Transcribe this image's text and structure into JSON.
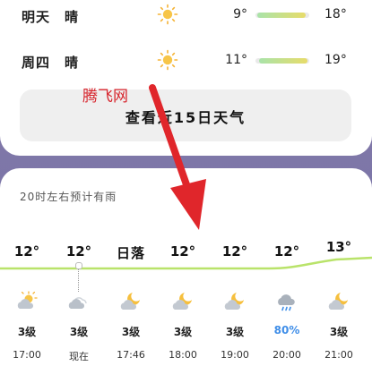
{
  "daily": [
    {
      "day": "明天",
      "condition": "晴",
      "icon": "sun-icon",
      "low": "9°",
      "high": "18°"
    },
    {
      "day": "周四",
      "condition": "晴",
      "icon": "sun-icon",
      "low": "11°",
      "high": "19°"
    }
  ],
  "forecast_button": "查看近15日天气",
  "watermark": "腾飞网",
  "rain_note": "20时左右预计有雨",
  "hourly": [
    {
      "temp": "12°",
      "icon": "partly-sunny-icon",
      "wind": "3级",
      "time": "17:00"
    },
    {
      "temp": "12°",
      "icon": "cloudy-icon",
      "wind": "3级",
      "time": "现在"
    },
    {
      "temp": "日落",
      "icon": "moon-cloud-icon",
      "wind": "3级",
      "time": "17:46"
    },
    {
      "temp": "12°",
      "icon": "moon-cloud-icon",
      "wind": "3级",
      "time": "18:00"
    },
    {
      "temp": "12°",
      "icon": "moon-cloud-icon",
      "wind": "3级",
      "time": "19:00"
    },
    {
      "temp": "12°",
      "icon": "rain-cloud-icon",
      "wind": "80%",
      "time": "20:00"
    },
    {
      "temp": "13°",
      "icon": "moon-cloud-icon",
      "wind": "3级",
      "time": "21:00"
    }
  ],
  "colors": {
    "rain_text": "#3f8ee8",
    "curve": "#b9e36a",
    "arrow": "#e0262b",
    "sun": "#f5b335"
  }
}
